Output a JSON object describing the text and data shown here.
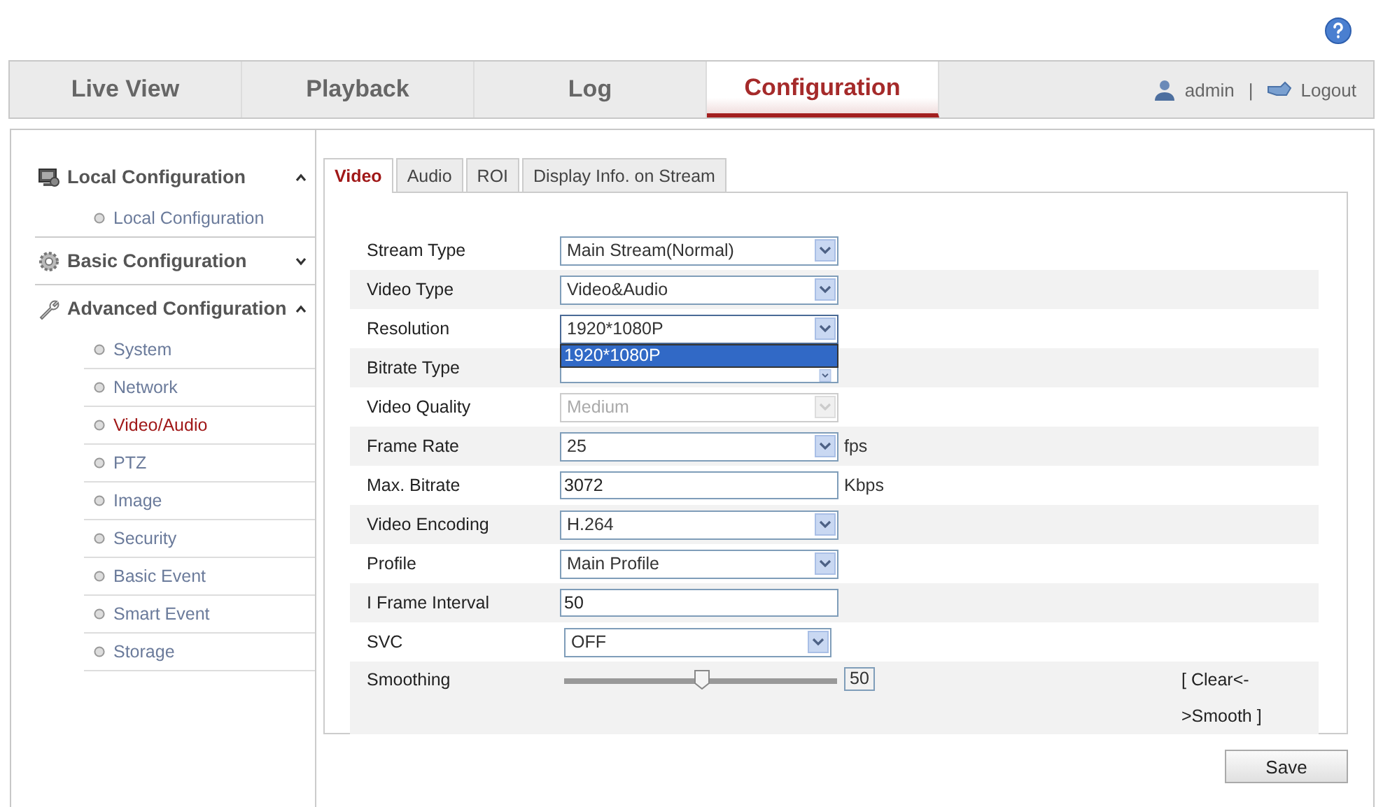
{
  "nav": {
    "tabs": [
      {
        "label": "Live View",
        "selected": false
      },
      {
        "label": "Playback",
        "selected": false
      },
      {
        "label": "Log",
        "selected": false
      },
      {
        "label": "Configuration",
        "selected": true
      }
    ],
    "user": "admin",
    "separator": "|",
    "logout": "Logout"
  },
  "sidebar": {
    "groups": [
      {
        "label": "Local Configuration",
        "expanded": true,
        "children": [
          {
            "label": "Local Configuration",
            "selected": false
          }
        ]
      },
      {
        "label": "Basic Configuration",
        "expanded": false
      },
      {
        "label": "Advanced Configuration",
        "expanded": true,
        "children": [
          {
            "label": "System",
            "selected": false
          },
          {
            "label": "Network",
            "selected": false
          },
          {
            "label": "Video/Audio",
            "selected": true
          },
          {
            "label": "PTZ",
            "selected": false
          },
          {
            "label": "Image",
            "selected": false
          },
          {
            "label": "Security",
            "selected": false
          },
          {
            "label": "Basic Event",
            "selected": false
          },
          {
            "label": "Smart Event",
            "selected": false
          },
          {
            "label": "Storage",
            "selected": false
          }
        ]
      }
    ]
  },
  "tabs": [
    {
      "label": "Video",
      "selected": true
    },
    {
      "label": "Audio",
      "selected": false
    },
    {
      "label": "ROI",
      "selected": false
    },
    {
      "label": "Display Info. on Stream",
      "selected": false
    }
  ],
  "rows": [
    {
      "kind": "select",
      "label": "Stream Type",
      "value": "Main Stream(Normal)",
      "disabled": false
    },
    {
      "kind": "select",
      "label": "Video Type",
      "value": "Video&Audio",
      "disabled": false
    },
    {
      "kind": "select",
      "label": "Resolution",
      "value": "1920*1080P",
      "disabled": false,
      "expanded": true,
      "options": [
        {
          "label": "1920*1080P",
          "selected": true
        }
      ]
    },
    {
      "kind": "select",
      "label": "Bitrate Type",
      "disabled": false
    },
    {
      "kind": "select",
      "label": "Video Quality",
      "value": "Medium",
      "disabled": true
    },
    {
      "kind": "select",
      "label": "Frame Rate",
      "value": "25",
      "disabled": false,
      "unit": "fps"
    },
    {
      "kind": "text",
      "label": "Max. Bitrate",
      "value": "3072",
      "unit": "Kbps"
    },
    {
      "kind": "select",
      "label": "Video Encoding",
      "value": "H.264",
      "disabled": false
    },
    {
      "kind": "select",
      "label": "Profile",
      "value": "Main Profile",
      "disabled": false
    },
    {
      "kind": "text",
      "label": "I Frame Interval",
      "value": "50"
    },
    {
      "kind": "select",
      "label": "SVC",
      "value": "OFF",
      "disabled": false
    },
    {
      "kind": "slider",
      "label": "Smoothing",
      "level": 0.5,
      "value": "50",
      "hint": "[ Clear<->Smooth ]"
    }
  ],
  "save": "Save"
}
